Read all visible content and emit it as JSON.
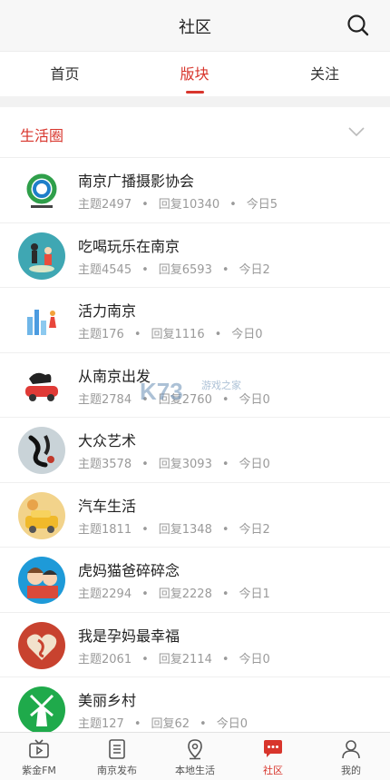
{
  "header": {
    "title": "社区",
    "search_icon": "search-icon"
  },
  "tabs": [
    {
      "label": "首页",
      "active": false
    },
    {
      "label": "版块",
      "active": true
    },
    {
      "label": "关注",
      "active": false
    }
  ],
  "section": {
    "title": "生活圈",
    "toggle_icon": "chevron-down-icon"
  },
  "forums": [
    {
      "name": "南京广播摄影协会",
      "topics": "主题2497",
      "replies": "回复10340",
      "today": "今日5",
      "avatar_icon": "photography-association-logo"
    },
    {
      "name": "吃喝玩乐在南京",
      "topics": "主题4545",
      "replies": "回复6593",
      "today": "今日2",
      "avatar_icon": "people-illustration-avatar"
    },
    {
      "name": "活力南京",
      "topics": "主题176",
      "replies": "回复1116",
      "today": "今日0",
      "avatar_icon": "city-sports-avatar"
    },
    {
      "name": "从南京出发",
      "topics": "主题2784",
      "replies": "回复2760",
      "today": "今日0",
      "avatar_icon": "car-travel-avatar"
    },
    {
      "name": "大众艺术",
      "topics": "主题3578",
      "replies": "回复3093",
      "today": "今日0",
      "avatar_icon": "calligraphy-art-avatar"
    },
    {
      "name": "汽车生活",
      "topics": "主题1811",
      "replies": "回复1348",
      "today": "今日2",
      "avatar_icon": "car-life-avatar"
    },
    {
      "name": "虎妈猫爸碎碎念",
      "topics": "主题2294",
      "replies": "回复2228",
      "today": "今日1",
      "avatar_icon": "cartoon-parents-avatar"
    },
    {
      "name": "我是孕妈最幸福",
      "topics": "主题2061",
      "replies": "回复2114",
      "today": "今日0",
      "avatar_icon": "pregnancy-heart-avatar"
    },
    {
      "name": "美丽乡村",
      "topics": "主题127",
      "replies": "回复62",
      "today": "今日0",
      "avatar_icon": "windmill-village-avatar"
    }
  ],
  "watermark": {
    "text": "游戏之家",
    "brand": "K73"
  },
  "bottom_nav": [
    {
      "label": "紫金FM",
      "icon": "tv-play-icon",
      "active": false
    },
    {
      "label": "南京发布",
      "icon": "document-icon",
      "active": false
    },
    {
      "label": "本地生活",
      "icon": "location-pin-icon",
      "active": false
    },
    {
      "label": "社区",
      "icon": "chat-bubble-icon",
      "active": true
    },
    {
      "label": "我的",
      "icon": "person-icon",
      "active": false
    }
  ],
  "colors": {
    "accent": "#d8352c",
    "meta_text": "#9a9a9a",
    "background": "#ffffff",
    "header_bg": "#f7f7f7"
  }
}
